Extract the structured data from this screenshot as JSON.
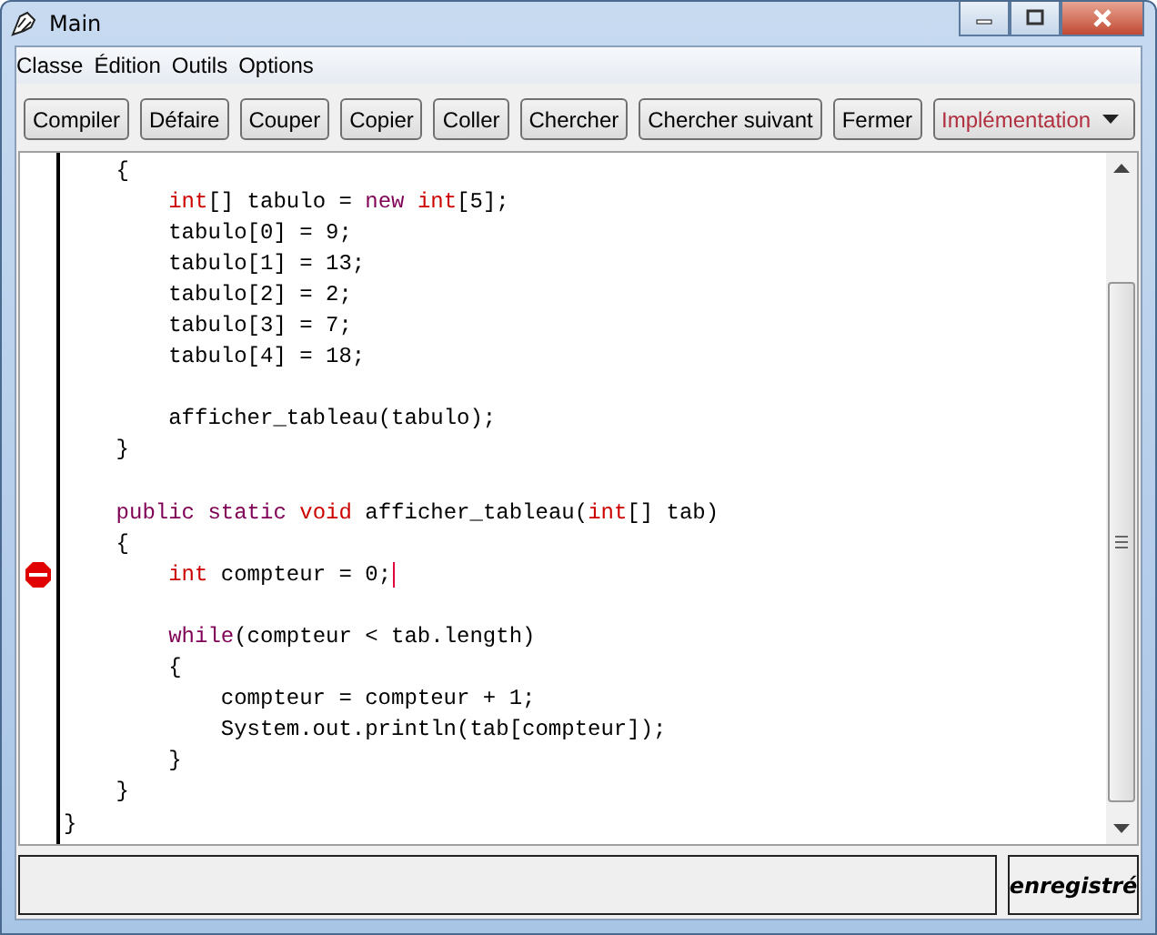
{
  "window": {
    "title": "Main"
  },
  "menu": [
    "Classe",
    "Édition",
    "Outils",
    "Options"
  ],
  "toolbar": {
    "buttons": [
      "Compiler",
      "Défaire",
      "Couper",
      "Copier",
      "Coller",
      "Chercher",
      "Chercher suivant",
      "Fermer"
    ],
    "view_select": {
      "value": "Implémentation"
    }
  },
  "editor": {
    "lines": [
      {
        "children": [
          {
            "kind": "code",
            "breakpoint": false,
            "caret": false,
            "tokens": [
              {
                "kind": "plain",
                "text": "{"
              }
            ],
            "children": [
              {
                "kind": "code",
                "breakpoint": false,
                "caret": false,
                "tokens": [
                  {
                    "kind": "type",
                    "text": "int"
                  },
                  {
                    "kind": "plain",
                    "text": "[] tabulo = "
                  },
                  {
                    "kind": "keyword",
                    "text": "new "
                  },
                  {
                    "kind": "type",
                    "text": "int"
                  },
                  {
                    "kind": "plain",
                    "text": "[5];"
                  }
                ]
              },
              {
                "kind": "code",
                "breakpoint": false,
                "caret": false,
                "tokens": [
                  {
                    "kind": "plain",
                    "text": "tabulo[0] = 9;"
                  }
                ]
              },
              {
                "kind": "code",
                "breakpoint": false,
                "caret": false,
                "tokens": [
                  {
                    "kind": "plain",
                    "text": "tabulo[1] = 13;"
                  }
                ]
              },
              {
                "kind": "code",
                "breakpoint": false,
                "caret": false,
                "tokens": [
                  {
                    "kind": "plain",
                    "text": "tabulo[2] = 2;"
                  }
                ]
              },
              {
                "kind": "code",
                "breakpoint": false,
                "caret": false,
                "tokens": [
                  {
                    "kind": "plain",
                    "text": "tabulo[3] = 7;"
                  }
                ]
              },
              {
                "kind": "code",
                "breakpoint": false,
                "caret": false,
                "tokens": [
                  {
                    "kind": "plain",
                    "text": "tabulo[4] = 18;"
                  }
                ]
              },
              {
                "kind": "blank"
              },
              {
                "kind": "code",
                "breakpoint": false,
                "caret": false,
                "tokens": [
                  {
                    "kind": "plain",
                    "text": "afficher_tableau(tabulo);"
                  }
                ]
              }
            ]
          },
          {
            "kind": "code",
            "breakpoint": false,
            "caret": false,
            "tokens": [
              {
                "kind": "plain",
                "text": "}"
              }
            ]
          },
          {
            "kind": "blank"
          },
          {
            "kind": "code",
            "breakpoint": false,
            "caret": false,
            "tokens": [
              {
                "kind": "keyword",
                "text": "public static "
              },
              {
                "kind": "type",
                "text": "void"
              },
              {
                "kind": "plain",
                "text": " afficher_tableau("
              },
              {
                "kind": "type",
                "text": "int"
              },
              {
                "kind": "plain",
                "text": "[] tab)"
              }
            ]
          },
          {
            "kind": "code",
            "breakpoint": false,
            "caret": false,
            "tokens": [
              {
                "kind": "plain",
                "text": "{"
              }
            ],
            "children": [
              {
                "kind": "code",
                "breakpoint": true,
                "caret": true,
                "tokens": [
                  {
                    "kind": "type",
                    "text": "int"
                  },
                  {
                    "kind": "plain",
                    "text": " compteur = 0;"
                  }
                ]
              },
              {
                "kind": "blank"
              },
              {
                "kind": "code",
                "breakpoint": false,
                "caret": false,
                "tokens": [
                  {
                    "kind": "keyword",
                    "text": "while"
                  },
                  {
                    "kind": "plain",
                    "text": "(compteur < tab.length)"
                  }
                ]
              },
              {
                "kind": "code",
                "breakpoint": false,
                "caret": false,
                "tokens": [
                  {
                    "kind": "plain",
                    "text": "{"
                  }
                ],
                "children": [
                  {
                    "kind": "code",
                    "breakpoint": false,
                    "caret": false,
                    "tokens": [
                      {
                        "kind": "plain",
                        "text": "compteur = compteur + 1;"
                      }
                    ]
                  },
                  {
                    "kind": "code",
                    "breakpoint": false,
                    "caret": false,
                    "tokens": [
                      {
                        "kind": "plain",
                        "text": "System.out.println(tab[compteur]);"
                      }
                    ]
                  }
                ]
              },
              {
                "kind": "code",
                "breakpoint": false,
                "caret": false,
                "tokens": [
                  {
                    "kind": "plain",
                    "text": "}"
                  }
                ]
              }
            ]
          },
          {
            "kind": "code",
            "breakpoint": false,
            "caret": false,
            "tokens": [
              {
                "kind": "plain",
                "text": "}"
              }
            ]
          }
        ]
      },
      {
        "kind": "code",
        "breakpoint": false,
        "caret": false,
        "tokens": [
          {
            "kind": "plain",
            "text": "}"
          }
        ]
      }
    ]
  },
  "status_bar": {
    "save_state": "enregistré"
  }
}
